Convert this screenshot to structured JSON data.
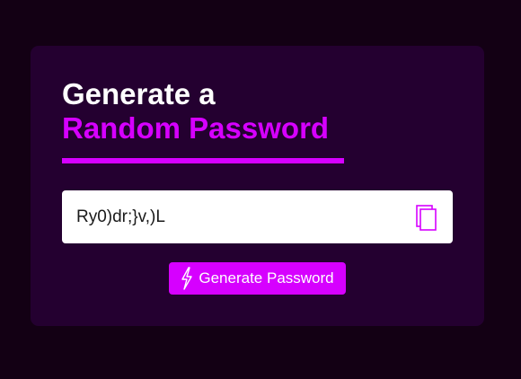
{
  "heading": {
    "line1": "Generate a",
    "line2": "Random Password"
  },
  "password": {
    "value": "Ry0)dr;}v,)L"
  },
  "icons": {
    "copy": "copy-icon",
    "generate": "lightning-bolt-icon"
  },
  "button": {
    "label": "Generate Password"
  },
  "colors": {
    "background": "#130014",
    "card": "#240030",
    "accent": "#d600ff",
    "text_light": "#ffffff"
  }
}
